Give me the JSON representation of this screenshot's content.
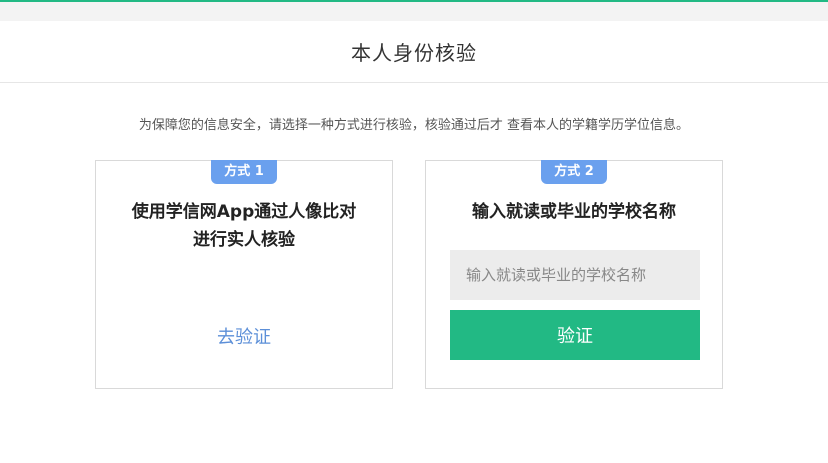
{
  "header": {
    "title": "本人身份核验"
  },
  "notice": "为保障您的信息安全，请选择一种方式进行核验，核验通过后才 查看本人的学籍学历学位信息。",
  "method1": {
    "badge": "方式 1",
    "title_line1": "使用学信网App通过人像比对",
    "title_line2": "进行实人核验",
    "link_label": "去验证"
  },
  "method2": {
    "badge": "方式 2",
    "title": "输入就读或毕业的学校名称",
    "input_value": "",
    "input_placeholder": "输入就读或毕业的学校名称",
    "button_label": "验证"
  },
  "colors": {
    "accent_green": "#22b984",
    "badge_blue": "#6aa0ee",
    "link_blue": "#5c8fd8"
  }
}
